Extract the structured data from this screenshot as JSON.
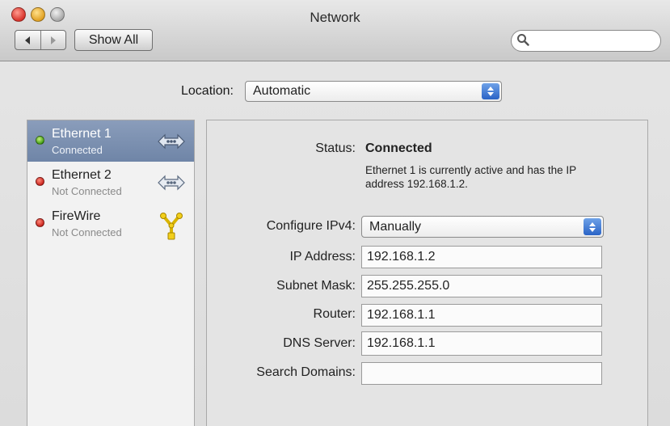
{
  "window": {
    "title": "Network"
  },
  "toolbar": {
    "show_all_label": "Show All",
    "search_placeholder": ""
  },
  "location": {
    "label": "Location:",
    "value": "Automatic"
  },
  "services": [
    {
      "name": "Ethernet 1",
      "status": "Connected",
      "status_color": "green",
      "icon": "ethernet-icon",
      "selected": true
    },
    {
      "name": "Ethernet 2",
      "status": "Not Connected",
      "status_color": "red",
      "icon": "ethernet-icon",
      "selected": false
    },
    {
      "name": "FireWire",
      "status": "Not Connected",
      "status_color": "red",
      "icon": "firewire-icon",
      "selected": false
    }
  ],
  "detail": {
    "status_label": "Status:",
    "status_value": "Connected",
    "status_description": "Ethernet 1 is currently active and has the IP address 192.168.1.2.",
    "configure_label": "Configure IPv4:",
    "configure_value": "Manually",
    "ip_label": "IP Address:",
    "ip_value": "192.168.1.2",
    "subnet_label": "Subnet Mask:",
    "subnet_value": "255.255.255.0",
    "router_label": "Router:",
    "router_value": "192.168.1.1",
    "dns_label": "DNS Server:",
    "dns_value": "192.168.1.1",
    "search_domains_label": "Search Domains:",
    "search_domains_value": ""
  },
  "colors": {
    "selection": "#7a8fb0",
    "status_green": "#3c9a12",
    "status_red": "#c8201a",
    "popup_accent": "#2a63c6"
  }
}
